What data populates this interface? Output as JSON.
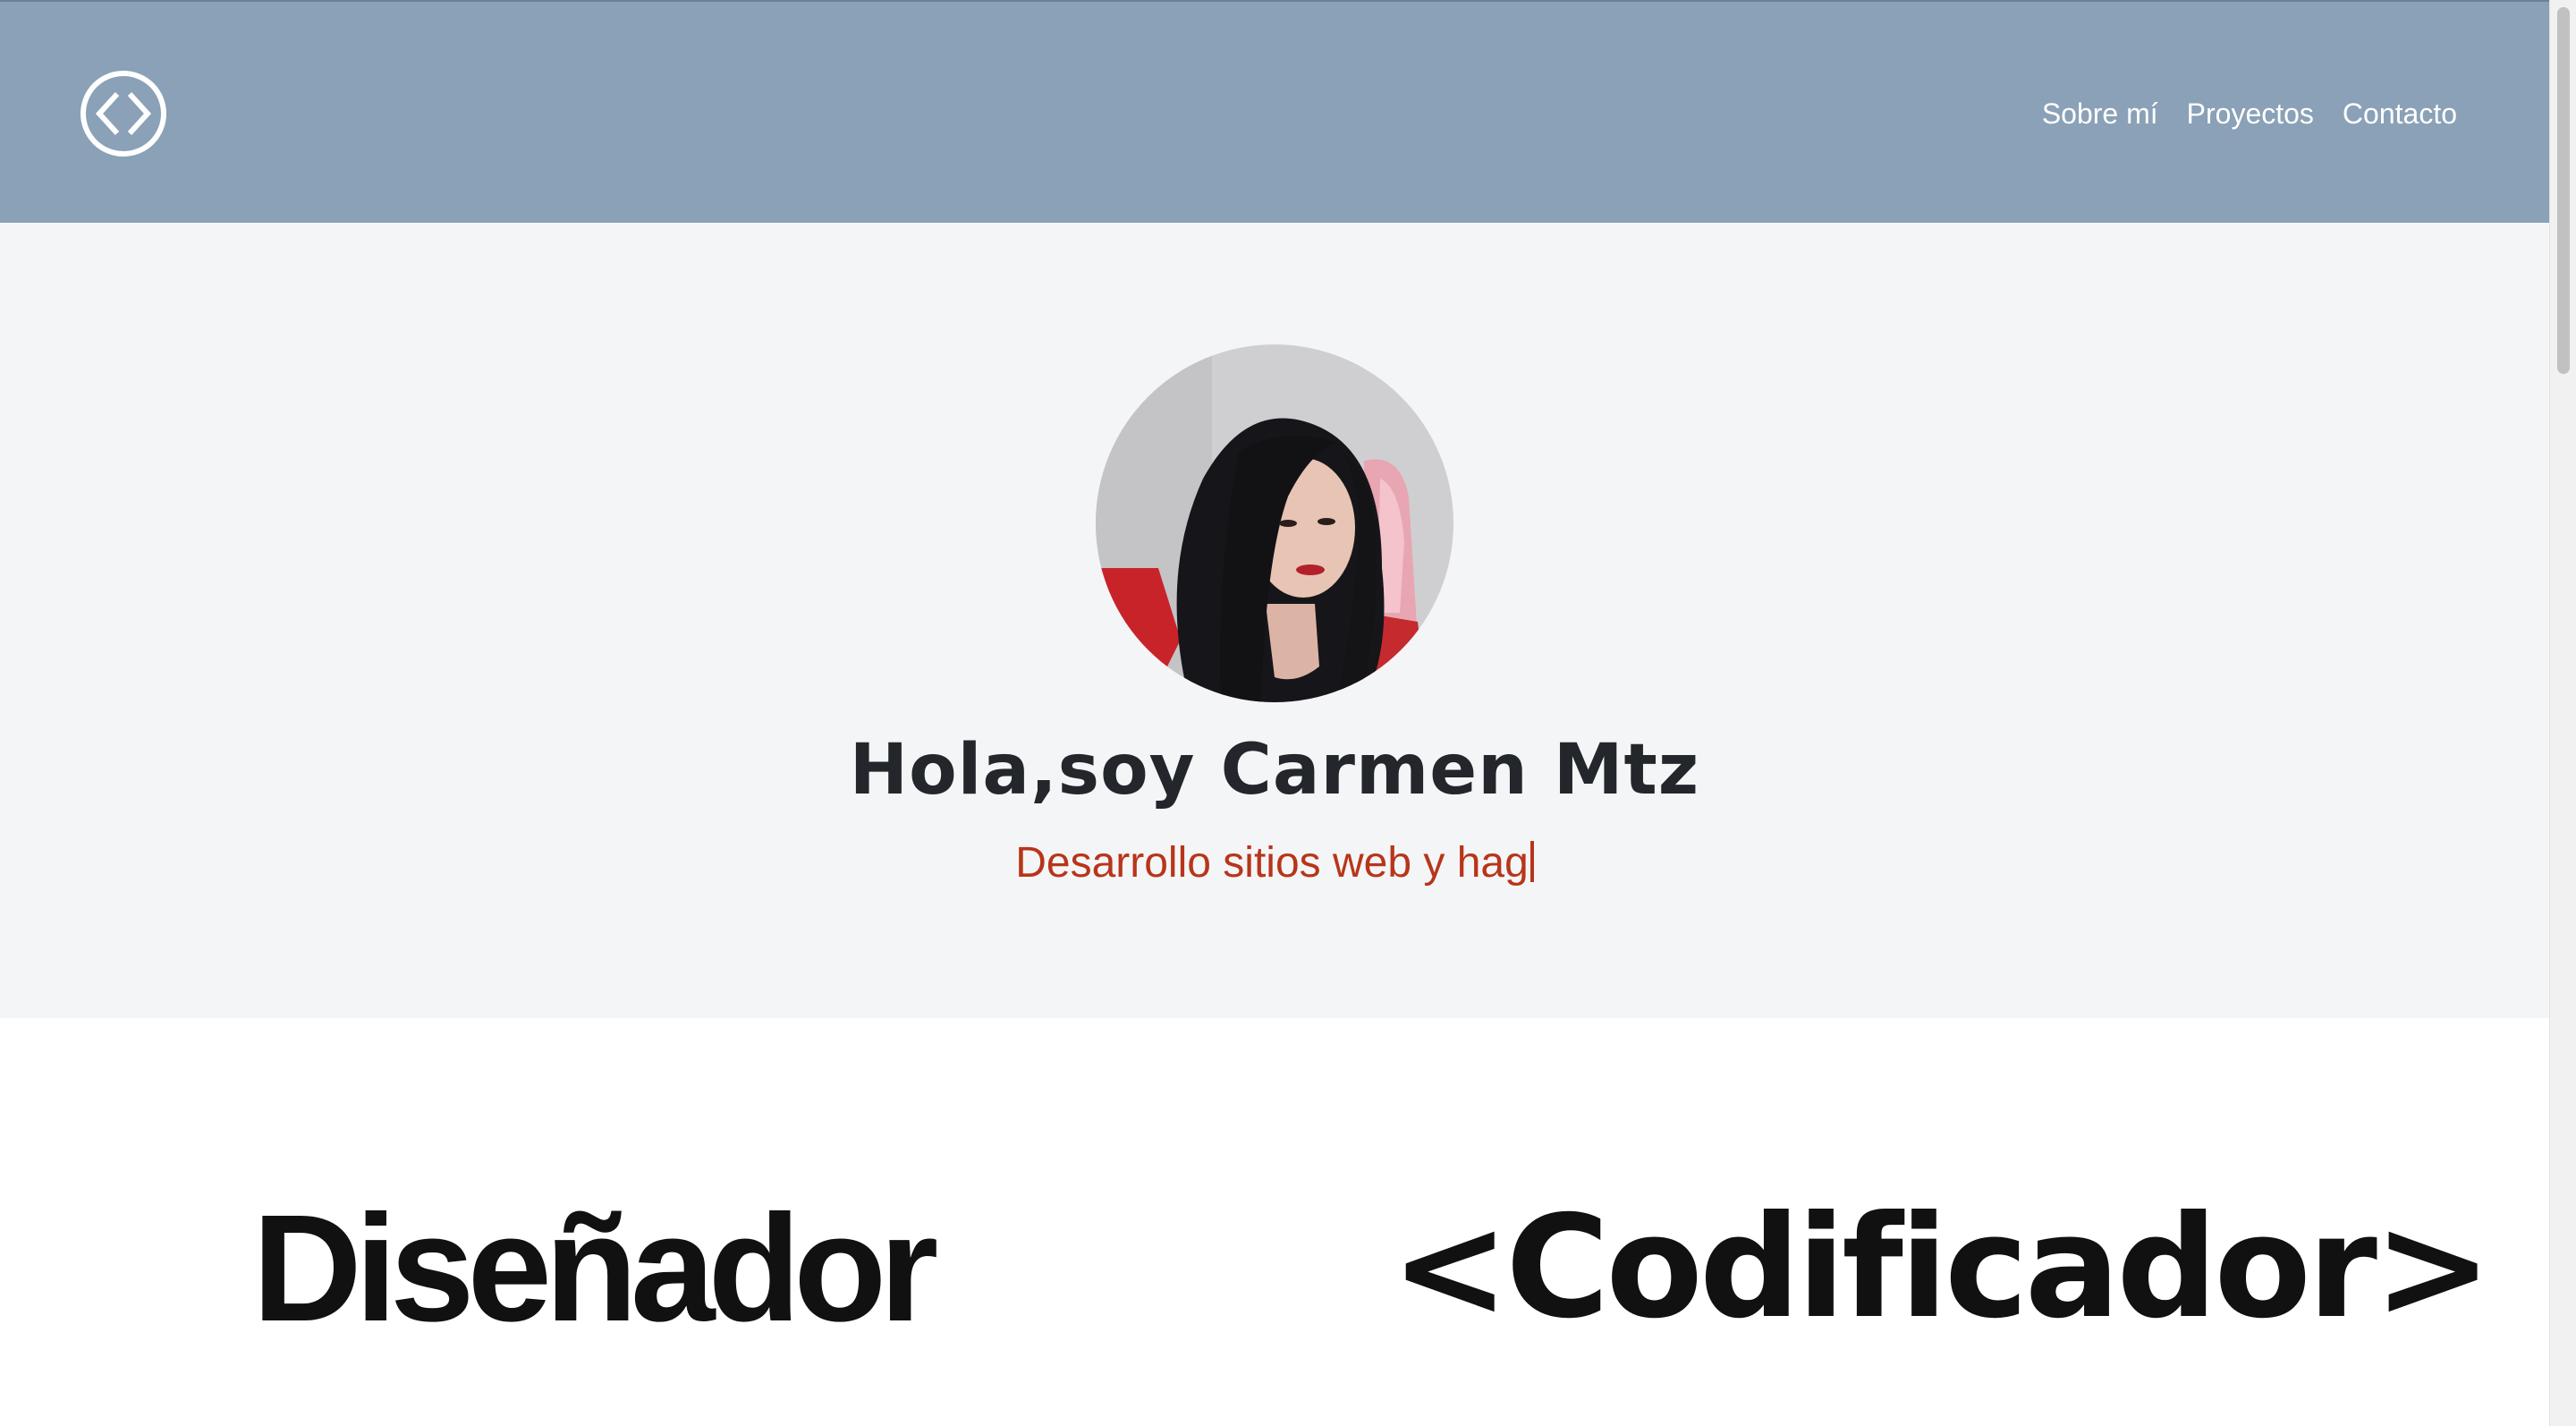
{
  "header": {
    "logo_icon": "code-brackets-circle-icon",
    "background_color": "#8aa1b7",
    "nav": [
      {
        "label": "Sobre mí"
      },
      {
        "label": "Proyectos"
      },
      {
        "label": "Contacto"
      }
    ]
  },
  "hero": {
    "background_color": "#f4f5f7",
    "title": "Hola,soy Carmen Mtz",
    "subtitle": "Desarrollo sitios web y hag",
    "subtitle_color": "#b8351a"
  },
  "roles": {
    "designer": "Diseñador",
    "coder": "<Codificador>"
  }
}
